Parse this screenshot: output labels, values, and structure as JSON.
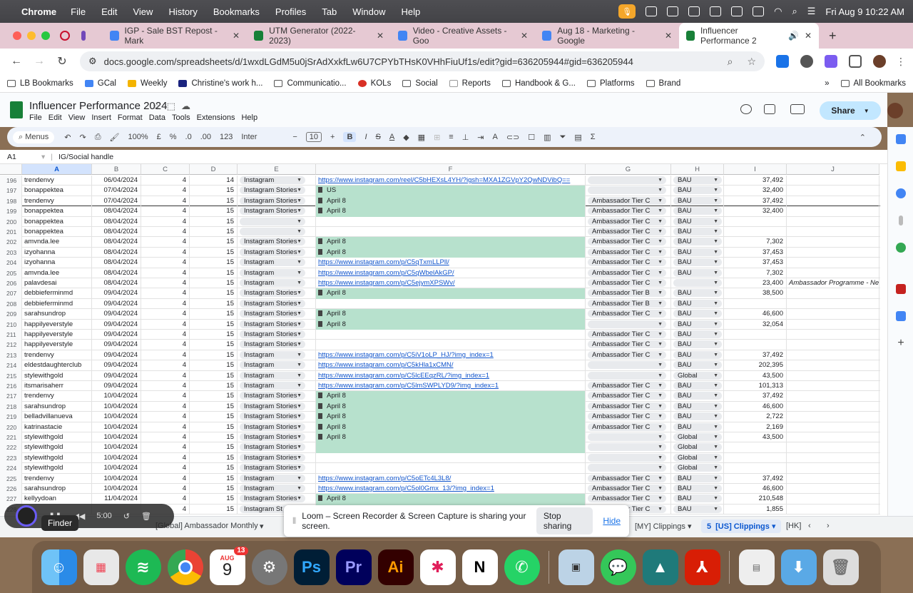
{
  "mac": {
    "app": "Chrome",
    "menus": [
      "File",
      "Edit",
      "View",
      "History",
      "Bookmarks",
      "Profiles",
      "Tab",
      "Window",
      "Help"
    ],
    "clock": "Fri Aug 9  10:22 AM"
  },
  "tabs": [
    {
      "title": "IGP - Sale BST Repost - Mark",
      "color": "#7248b9"
    },
    {
      "title": "UTM Generator (2022-2023)",
      "color": "#188038"
    },
    {
      "title": "Video - Creative Assets - Goo",
      "color": "#4285f4"
    },
    {
      "title": "Aug 18 - Marketing - Google",
      "color": "#4285f4"
    },
    {
      "title": "Influencer Performance 2",
      "color": "#188038"
    }
  ],
  "url": "docs.google.com/spreadsheets/d/1wxdLGdM5u0jSrAdXxkfLw6U7CPYbTHsK0VHhFiuUf1s/edit?gid=636205944#gid=636205944",
  "bookmarks": [
    "LB Bookmarks",
    "GCal",
    "Weekly",
    "Christine's work h...",
    "Communicatio...",
    "KOLs",
    "Social",
    "Reports",
    "Handbook & G...",
    "Platforms",
    "Brand"
  ],
  "bookmarks_right": "All Bookmarks",
  "doc": {
    "title": "Influencer Performance 2024",
    "menus": [
      "File",
      "Edit",
      "View",
      "Insert",
      "Format",
      "Data",
      "Tools",
      "Extensions",
      "Help"
    ],
    "share": "Share"
  },
  "toolbar": {
    "search": "Menus",
    "zoom": "100%",
    "currency": "£",
    "percent": "%",
    "dec_less": ".0",
    "dec_more": ".00",
    "format": "123",
    "font": "Inter",
    "size": "10"
  },
  "formula": {
    "ref": "A1",
    "content": "IG/Social handle"
  },
  "columns": [
    "A",
    "B",
    "C",
    "D",
    "E",
    "F",
    "G",
    "H",
    "I",
    "J"
  ],
  "rows": [
    [
      "196",
      "trendenvy",
      "06/04/2024",
      "4",
      "14",
      "Instagram",
      "https://www.instagram.com/reel/C5bHEXsL4YH/?igsh=MXA1ZGVpY2QwNDVibQ==",
      "",
      "BAU",
      "37,492",
      ""
    ],
    [
      "197",
      "bonappektea",
      "07/04/2024",
      "4",
      "15",
      "Instagram Stories",
      "US",
      "",
      "BAU",
      "32,400",
      ""
    ],
    [
      "198",
      "trendenvy",
      "07/04/2024",
      "4",
      "15",
      "Instagram Stories",
      "April 8",
      "Ambassador Tier C",
      "BAU",
      "37,492",
      ""
    ],
    [
      "199",
      "bonappektea",
      "08/04/2024",
      "4",
      "15",
      "Instagram Stories",
      "April 8",
      "Ambassador Tier C",
      "BAU",
      "32,400",
      ""
    ],
    [
      "200",
      "bonappektea",
      "08/04/2024",
      "4",
      "15",
      "",
      "",
      "Ambassador Tier C",
      "BAU",
      "",
      ""
    ],
    [
      "201",
      "bonappektea",
      "08/04/2024",
      "4",
      "15",
      "",
      "",
      "Ambassador Tier C",
      "BAU",
      "",
      ""
    ],
    [
      "202",
      "amvnda.lee",
      "08/04/2024",
      "4",
      "15",
      "Instagram Stories",
      "April 8",
      "Ambassador Tier C",
      "BAU",
      "7,302",
      ""
    ],
    [
      "203",
      "izyohanna",
      "08/04/2024",
      "4",
      "15",
      "Instagram Stories",
      "April 8",
      "Ambassador Tier C",
      "BAU",
      "37,453",
      ""
    ],
    [
      "204",
      "izyohanna",
      "08/04/2024",
      "4",
      "15",
      "Instagram",
      "https://www.instagram.com/p/C5qTxmLLPll/",
      "Ambassador Tier C",
      "BAU",
      "37,453",
      ""
    ],
    [
      "205",
      "amvnda.lee",
      "08/04/2024",
      "4",
      "15",
      "Instagram",
      "https://www.instagram.com/p/C5qWbelAkGP/",
      "Ambassador Tier C",
      "BAU",
      "7,302",
      ""
    ],
    [
      "206",
      "palavdesai",
      "08/04/2024",
      "4",
      "15",
      "Instagram",
      "https://www.instagram.com/p/C5ejymXPSWv/",
      "Ambassador Tier C",
      "",
      "23,400",
      "Ambassador Programme - Ne"
    ],
    [
      "207",
      "debbieferminmd",
      "09/04/2024",
      "4",
      "15",
      "Instagram Stories",
      "April 8",
      "Ambassador Tier B",
      "BAU",
      "38,500",
      ""
    ],
    [
      "208",
      "debbieferminmd",
      "09/04/2024",
      "4",
      "15",
      "Instagram Stories",
      "",
      "Ambassador Tier B",
      "BAU",
      "",
      ""
    ],
    [
      "209",
      "sarahsundrop",
      "09/04/2024",
      "4",
      "15",
      "Instagram Stories",
      "April 8",
      "Ambassador Tier C",
      "BAU",
      "46,600",
      ""
    ],
    [
      "210",
      "happilyeverstyle",
      "09/04/2024",
      "4",
      "15",
      "Instagram Stories",
      "April 8",
      "",
      "BAU",
      "32,054",
      ""
    ],
    [
      "211",
      "happilyeverstyle",
      "09/04/2024",
      "4",
      "15",
      "Instagram Stories",
      "",
      "Ambassador Tier C",
      "BAU",
      "",
      ""
    ],
    [
      "212",
      "happilyeverstyle",
      "09/04/2024",
      "4",
      "15",
      "Instagram Stories",
      "",
      "Ambassador Tier C",
      "BAU",
      "",
      ""
    ],
    [
      "213",
      "trendenvy",
      "09/04/2024",
      "4",
      "15",
      "Instagram",
      "https://www.instagram.com/p/C5iV1oLP_HJ/?img_index=1",
      "Ambassador Tier C",
      "BAU",
      "37,492",
      ""
    ],
    [
      "214",
      "eldestdaughterclub",
      "09/04/2024",
      "4",
      "15",
      "Instagram",
      "https://www.instagram.com/p/C5kHla1xCMN/",
      "",
      "BAU",
      "202,395",
      ""
    ],
    [
      "215",
      "stylewithgold",
      "09/04/2024",
      "4",
      "15",
      "Instagram",
      "https://www.instagram.com/p/C5lcEEqzRL/?img_index=1",
      "",
      "Global",
      "43,500",
      ""
    ],
    [
      "216",
      "itsmarisaherr",
      "09/04/2024",
      "4",
      "15",
      "Instagram",
      "https://www.instagram.com/p/C5lmSWPLYD9/?img_index=1",
      "Ambassador Tier C",
      "BAU",
      "101,313",
      ""
    ],
    [
      "217",
      "trendenvy",
      "10/04/2024",
      "4",
      "15",
      "Instagram Stories",
      "April 8",
      "Ambassador Tier C",
      "BAU",
      "37,492",
      ""
    ],
    [
      "218",
      "sarahsundrop",
      "10/04/2024",
      "4",
      "15",
      "Instagram Stories",
      "April 8",
      "Ambassador Tier C",
      "BAU",
      "46,600",
      ""
    ],
    [
      "219",
      "belladvillanueva",
      "10/04/2024",
      "4",
      "15",
      "Instagram Stories",
      "April 8",
      "Ambassador Tier C",
      "BAU",
      "2,722",
      ""
    ],
    [
      "220",
      "katrinastacie",
      "10/04/2024",
      "4",
      "15",
      "Instagram Stories",
      "April 8",
      "Ambassador Tier C",
      "BAU",
      "2,169",
      ""
    ],
    [
      "221",
      "stylewithgold",
      "10/04/2024",
      "4",
      "15",
      "Instagram Stories",
      "April 8",
      "",
      "Global",
      "43,500",
      ""
    ],
    [
      "222",
      "stylewithgold",
      "10/04/2024",
      "4",
      "15",
      "Instagram Stories",
      "",
      "",
      "Global",
      "",
      ""
    ],
    [
      "223",
      "stylewithgold",
      "10/04/2024",
      "4",
      "15",
      "Instagram Stories",
      "",
      "",
      "Global",
      "",
      ""
    ],
    [
      "224",
      "stylewithgold",
      "10/04/2024",
      "4",
      "15",
      "Instagram Stories",
      "",
      "",
      "Global",
      "",
      ""
    ],
    [
      "225",
      "trendenvy",
      "10/04/2024",
      "4",
      "15",
      "Instagram",
      "https://www.instagram.com/p/C5oETc4L3L8/",
      "Ambassador Tier C",
      "BAU",
      "37,492",
      ""
    ],
    [
      "226",
      "sarahsundrop",
      "10/04/2024",
      "4",
      "15",
      "Instagram",
      "https://www.instagram.com/p/C5ol0Gmx_13/?img_index=1",
      "Ambassador Tier C",
      "BAU",
      "46,600",
      ""
    ],
    [
      "227",
      "kellyydoan",
      "11/04/2024",
      "4",
      "15",
      "Instagram Stories",
      "April 8",
      "Ambassador Tier C",
      "BAU",
      "210,548",
      ""
    ],
    [
      "228",
      "",
      "",
      "4",
      "15",
      "Instagram St",
      "",
      "Ambassador Tier C",
      "BAU",
      "1,855",
      ""
    ]
  ],
  "sheet_tabs": [
    {
      "label": "[Global] Ambassador Monthly"
    },
    {
      "label": "[MY] Clippings"
    },
    {
      "label": "[US] Clippings",
      "num": "5"
    },
    {
      "label": "[HK]"
    }
  ],
  "loom": {
    "message": "Loom – Screen Recorder & Screen Capture is sharing your screen.",
    "stop": "Stop sharing",
    "hide": "Hide",
    "timer": "5:00"
  },
  "tooltip": "Finder",
  "dock": {
    "calendar_month": "AUG",
    "calendar_day": "9",
    "calendar_badge": "13"
  }
}
